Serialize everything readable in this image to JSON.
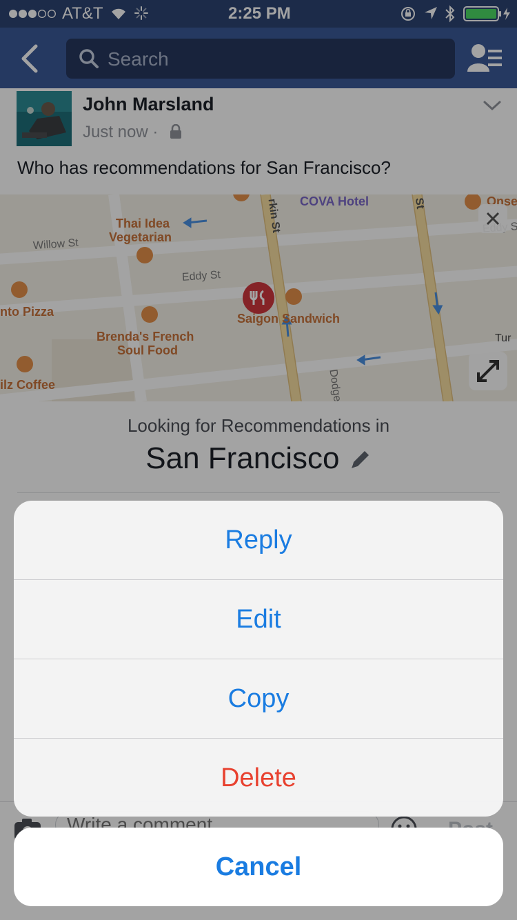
{
  "status_bar": {
    "carrier": "AT&T",
    "time": "2:25 PM"
  },
  "nav": {
    "search_placeholder": "Search"
  },
  "post": {
    "author": "John Marsland",
    "timestamp": "Just now",
    "separator": "·",
    "text": "Who has recommendations for San Francisco?"
  },
  "map": {
    "pois": {
      "cova_hotel": "COVA Hotel",
      "thai_idea": "Thai Idea",
      "vegetarian": "Vegetarian",
      "pizza": "nto Pizza",
      "saigon": "Saigon Sandwich",
      "brendas_1": "Brenda's French",
      "brendas_2": "Soul Food",
      "coffee": "ilz Coffee",
      "onse": "Onse"
    },
    "streets": {
      "willow": "Willow St",
      "eddy": "Eddy St",
      "larkin": "rkin St",
      "st": "St",
      "dodge": "Dodge",
      "turk": "Tur",
      "eddy_s": "Eddy S"
    }
  },
  "recommendations": {
    "caption": "Looking for Recommendations in",
    "city": "San Francisco"
  },
  "background": {
    "comment_placeholder": "Write a comment...",
    "post_label": "Post"
  },
  "action_sheet": {
    "reply": "Reply",
    "edit": "Edit",
    "copy": "Copy",
    "delete": "Delete",
    "cancel": "Cancel"
  },
  "colors": {
    "facebook_blue": "#3b5998",
    "action_blue": "#1a7ce1",
    "destructive_red": "#e8412f"
  }
}
